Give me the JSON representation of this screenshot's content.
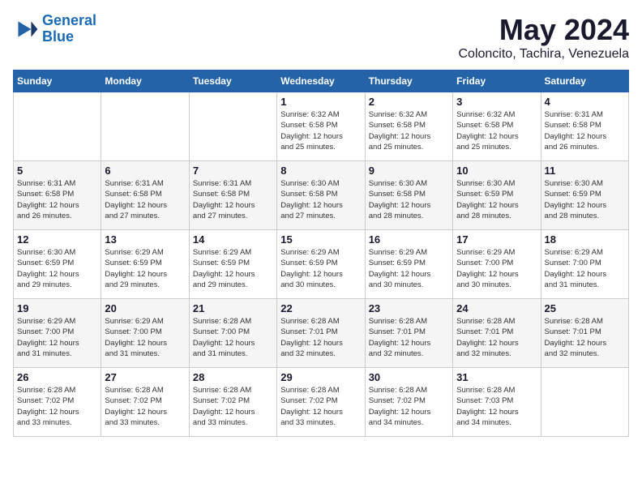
{
  "logo": {
    "line1": "General",
    "line2": "Blue",
    "icon": "▶"
  },
  "title": "May 2024",
  "location": "Coloncito, Tachira, Venezuela",
  "weekdays": [
    "Sunday",
    "Monday",
    "Tuesday",
    "Wednesday",
    "Thursday",
    "Friday",
    "Saturday"
  ],
  "weeks": [
    [
      {
        "day": "",
        "info": ""
      },
      {
        "day": "",
        "info": ""
      },
      {
        "day": "",
        "info": ""
      },
      {
        "day": "1",
        "info": "Sunrise: 6:32 AM\nSunset: 6:58 PM\nDaylight: 12 hours\nand 25 minutes."
      },
      {
        "day": "2",
        "info": "Sunrise: 6:32 AM\nSunset: 6:58 PM\nDaylight: 12 hours\nand 25 minutes."
      },
      {
        "day": "3",
        "info": "Sunrise: 6:32 AM\nSunset: 6:58 PM\nDaylight: 12 hours\nand 25 minutes."
      },
      {
        "day": "4",
        "info": "Sunrise: 6:31 AM\nSunset: 6:58 PM\nDaylight: 12 hours\nand 26 minutes."
      }
    ],
    [
      {
        "day": "5",
        "info": "Sunrise: 6:31 AM\nSunset: 6:58 PM\nDaylight: 12 hours\nand 26 minutes."
      },
      {
        "day": "6",
        "info": "Sunrise: 6:31 AM\nSunset: 6:58 PM\nDaylight: 12 hours\nand 27 minutes."
      },
      {
        "day": "7",
        "info": "Sunrise: 6:31 AM\nSunset: 6:58 PM\nDaylight: 12 hours\nand 27 minutes."
      },
      {
        "day": "8",
        "info": "Sunrise: 6:30 AM\nSunset: 6:58 PM\nDaylight: 12 hours\nand 27 minutes."
      },
      {
        "day": "9",
        "info": "Sunrise: 6:30 AM\nSunset: 6:58 PM\nDaylight: 12 hours\nand 28 minutes."
      },
      {
        "day": "10",
        "info": "Sunrise: 6:30 AM\nSunset: 6:59 PM\nDaylight: 12 hours\nand 28 minutes."
      },
      {
        "day": "11",
        "info": "Sunrise: 6:30 AM\nSunset: 6:59 PM\nDaylight: 12 hours\nand 28 minutes."
      }
    ],
    [
      {
        "day": "12",
        "info": "Sunrise: 6:30 AM\nSunset: 6:59 PM\nDaylight: 12 hours\nand 29 minutes."
      },
      {
        "day": "13",
        "info": "Sunrise: 6:29 AM\nSunset: 6:59 PM\nDaylight: 12 hours\nand 29 minutes."
      },
      {
        "day": "14",
        "info": "Sunrise: 6:29 AM\nSunset: 6:59 PM\nDaylight: 12 hours\nand 29 minutes."
      },
      {
        "day": "15",
        "info": "Sunrise: 6:29 AM\nSunset: 6:59 PM\nDaylight: 12 hours\nand 30 minutes."
      },
      {
        "day": "16",
        "info": "Sunrise: 6:29 AM\nSunset: 6:59 PM\nDaylight: 12 hours\nand 30 minutes."
      },
      {
        "day": "17",
        "info": "Sunrise: 6:29 AM\nSunset: 7:00 PM\nDaylight: 12 hours\nand 30 minutes."
      },
      {
        "day": "18",
        "info": "Sunrise: 6:29 AM\nSunset: 7:00 PM\nDaylight: 12 hours\nand 31 minutes."
      }
    ],
    [
      {
        "day": "19",
        "info": "Sunrise: 6:29 AM\nSunset: 7:00 PM\nDaylight: 12 hours\nand 31 minutes."
      },
      {
        "day": "20",
        "info": "Sunrise: 6:29 AM\nSunset: 7:00 PM\nDaylight: 12 hours\nand 31 minutes."
      },
      {
        "day": "21",
        "info": "Sunrise: 6:28 AM\nSunset: 7:00 PM\nDaylight: 12 hours\nand 31 minutes."
      },
      {
        "day": "22",
        "info": "Sunrise: 6:28 AM\nSunset: 7:01 PM\nDaylight: 12 hours\nand 32 minutes."
      },
      {
        "day": "23",
        "info": "Sunrise: 6:28 AM\nSunset: 7:01 PM\nDaylight: 12 hours\nand 32 minutes."
      },
      {
        "day": "24",
        "info": "Sunrise: 6:28 AM\nSunset: 7:01 PM\nDaylight: 12 hours\nand 32 minutes."
      },
      {
        "day": "25",
        "info": "Sunrise: 6:28 AM\nSunset: 7:01 PM\nDaylight: 12 hours\nand 32 minutes."
      }
    ],
    [
      {
        "day": "26",
        "info": "Sunrise: 6:28 AM\nSunset: 7:02 PM\nDaylight: 12 hours\nand 33 minutes."
      },
      {
        "day": "27",
        "info": "Sunrise: 6:28 AM\nSunset: 7:02 PM\nDaylight: 12 hours\nand 33 minutes."
      },
      {
        "day": "28",
        "info": "Sunrise: 6:28 AM\nSunset: 7:02 PM\nDaylight: 12 hours\nand 33 minutes."
      },
      {
        "day": "29",
        "info": "Sunrise: 6:28 AM\nSunset: 7:02 PM\nDaylight: 12 hours\nand 33 minutes."
      },
      {
        "day": "30",
        "info": "Sunrise: 6:28 AM\nSunset: 7:02 PM\nDaylight: 12 hours\nand 34 minutes."
      },
      {
        "day": "31",
        "info": "Sunrise: 6:28 AM\nSunset: 7:03 PM\nDaylight: 12 hours\nand 34 minutes."
      },
      {
        "day": "",
        "info": ""
      }
    ]
  ]
}
